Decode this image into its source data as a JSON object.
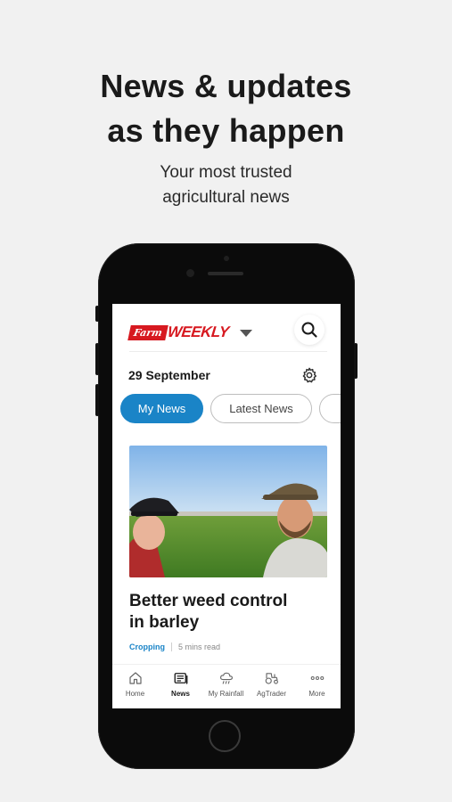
{
  "promo": {
    "headline_line1": "News & updates",
    "headline_line2": "as they happen",
    "subline_line1": "Your most trusted",
    "subline_line2": "agricultural news"
  },
  "app": {
    "logo_farm": "Farm",
    "logo_weekly": "WEEKLY",
    "date": "29 September",
    "tabs": [
      {
        "label": "My News",
        "active": true
      },
      {
        "label": "Latest News",
        "active": false
      }
    ],
    "article": {
      "title_line1": "Better weed control",
      "title_line2": "in barley",
      "category": "Cropping",
      "read_time": "5 mins read"
    },
    "nav": [
      {
        "label": "Home",
        "icon": "home-icon"
      },
      {
        "label": "News",
        "icon": "news-icon",
        "active": true
      },
      {
        "label": "My Rainfall",
        "icon": "rain-cloud-icon"
      },
      {
        "label": "AgTrader",
        "icon": "tractor-icon"
      },
      {
        "label": "More",
        "icon": "more-dots-icon"
      }
    ]
  },
  "colors": {
    "brand_red": "#d71920",
    "accent_blue": "#1a84c7",
    "background": "#f1f1f1"
  }
}
